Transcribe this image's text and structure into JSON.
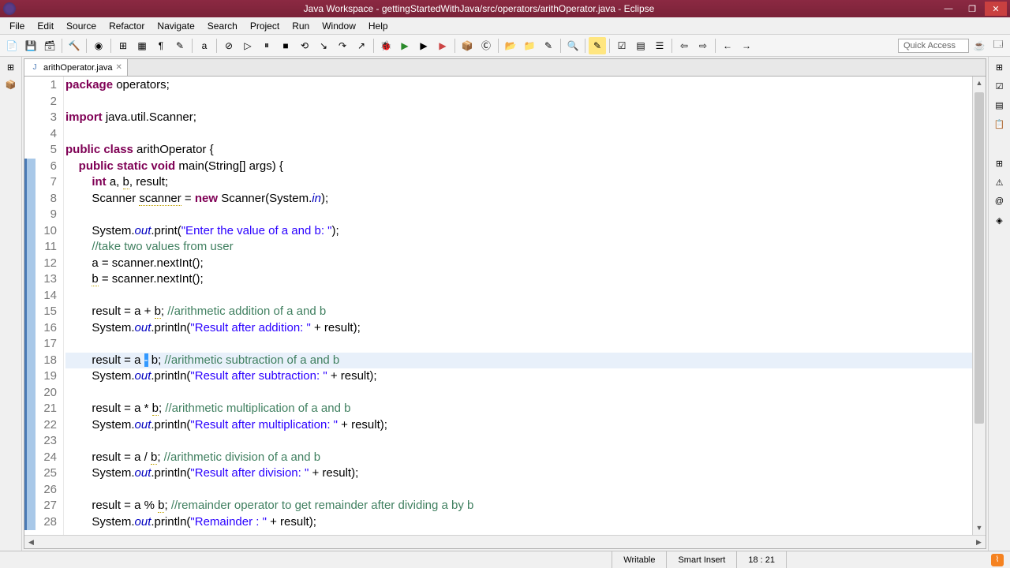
{
  "window": {
    "title": "Java Workspace - gettingStartedWithJava/src/operators/arithOperator.java - Eclipse"
  },
  "menu": [
    "File",
    "Edit",
    "Source",
    "Refactor",
    "Navigate",
    "Search",
    "Project",
    "Run",
    "Window",
    "Help"
  ],
  "quick_access": "Quick Access",
  "tab": {
    "label": "arithOperator.java"
  },
  "status": {
    "writable": "Writable",
    "insert": "Smart Insert",
    "pos": "18 : 21"
  },
  "code": {
    "lines": [
      {
        "n": 1,
        "seg": [
          {
            "c": "kw",
            "t": "package"
          },
          {
            "t": " operators;"
          }
        ]
      },
      {
        "n": 2,
        "seg": []
      },
      {
        "n": 3,
        "seg": [
          {
            "c": "kw",
            "t": "import"
          },
          {
            "t": " java.util.Scanner;"
          }
        ]
      },
      {
        "n": 4,
        "seg": []
      },
      {
        "n": 5,
        "seg": [
          {
            "c": "kw",
            "t": "public"
          },
          {
            "t": " "
          },
          {
            "c": "kw",
            "t": "class"
          },
          {
            "t": " arithOperator {"
          }
        ]
      },
      {
        "n": 6,
        "mark": true,
        "seg": [
          {
            "t": "    "
          },
          {
            "c": "kw",
            "t": "public"
          },
          {
            "t": " "
          },
          {
            "c": "kw",
            "t": "static"
          },
          {
            "t": " "
          },
          {
            "c": "kw",
            "t": "void"
          },
          {
            "t": " main(String[] args) {"
          }
        ]
      },
      {
        "n": 7,
        "mark": true,
        "seg": [
          {
            "t": "        "
          },
          {
            "c": "kw",
            "t": "int"
          },
          {
            "t": " a, "
          },
          {
            "c": "warn",
            "t": "b"
          },
          {
            "t": ", result;"
          }
        ]
      },
      {
        "n": 8,
        "mark": true,
        "seg": [
          {
            "t": "        Scanner "
          },
          {
            "c": "warn",
            "t": "scanner"
          },
          {
            "t": " = "
          },
          {
            "c": "kw",
            "t": "new"
          },
          {
            "t": " Scanner(System."
          },
          {
            "c": "fld",
            "t": "in"
          },
          {
            "t": ");"
          }
        ]
      },
      {
        "n": 9,
        "mark": true,
        "seg": []
      },
      {
        "n": 10,
        "mark": true,
        "seg": [
          {
            "t": "        System."
          },
          {
            "c": "fld",
            "t": "out"
          },
          {
            "t": ".print("
          },
          {
            "c": "str",
            "t": "\"Enter the value of a and b: \""
          },
          {
            "t": ");"
          }
        ]
      },
      {
        "n": 11,
        "mark": true,
        "seg": [
          {
            "t": "        "
          },
          {
            "c": "cmt",
            "t": "//take two values from user"
          }
        ]
      },
      {
        "n": 12,
        "mark": true,
        "seg": [
          {
            "t": "        a = scanner.nextInt();"
          }
        ]
      },
      {
        "n": 13,
        "mark": true,
        "seg": [
          {
            "t": "        "
          },
          {
            "c": "warn",
            "t": "b"
          },
          {
            "t": " = scanner.nextInt();"
          }
        ]
      },
      {
        "n": 14,
        "mark": true,
        "seg": []
      },
      {
        "n": 15,
        "mark": true,
        "seg": [
          {
            "t": "        result = a + "
          },
          {
            "c": "warn",
            "t": "b"
          },
          {
            "t": "; "
          },
          {
            "c": "cmt",
            "t": "//arithmetic addition of a and b"
          }
        ]
      },
      {
        "n": 16,
        "mark": true,
        "seg": [
          {
            "t": "        System."
          },
          {
            "c": "fld",
            "t": "out"
          },
          {
            "t": ".println("
          },
          {
            "c": "str",
            "t": "\"Result after addition: \""
          },
          {
            "t": " + result);"
          }
        ]
      },
      {
        "n": 17,
        "mark": true,
        "seg": []
      },
      {
        "n": 18,
        "mark": true,
        "hl": true,
        "seg": [
          {
            "t": "        result = a "
          },
          {
            "c": "sel",
            "t": "-"
          },
          {
            "t": " b; "
          },
          {
            "c": "cmt",
            "t": "//arithmetic subtraction of a and b"
          }
        ]
      },
      {
        "n": 19,
        "mark": true,
        "seg": [
          {
            "t": "        System."
          },
          {
            "c": "fld",
            "t": "out"
          },
          {
            "t": ".println("
          },
          {
            "c": "str",
            "t": "\"Result after subtraction: \""
          },
          {
            "t": " + result);"
          }
        ]
      },
      {
        "n": 20,
        "mark": true,
        "seg": []
      },
      {
        "n": 21,
        "mark": true,
        "seg": [
          {
            "t": "        result = a * "
          },
          {
            "c": "warn",
            "t": "b"
          },
          {
            "t": "; "
          },
          {
            "c": "cmt",
            "t": "//arithmetic multiplication of a and b"
          }
        ]
      },
      {
        "n": 22,
        "mark": true,
        "seg": [
          {
            "t": "        System."
          },
          {
            "c": "fld",
            "t": "out"
          },
          {
            "t": ".println("
          },
          {
            "c": "str",
            "t": "\"Result after multiplication: \""
          },
          {
            "t": " + result);"
          }
        ]
      },
      {
        "n": 23,
        "mark": true,
        "seg": []
      },
      {
        "n": 24,
        "mark": true,
        "seg": [
          {
            "t": "        result = a / "
          },
          {
            "c": "warn",
            "t": "b"
          },
          {
            "t": "; "
          },
          {
            "c": "cmt",
            "t": "//arithmetic division of a and b"
          }
        ]
      },
      {
        "n": 25,
        "mark": true,
        "seg": [
          {
            "t": "        System."
          },
          {
            "c": "fld",
            "t": "out"
          },
          {
            "t": ".println("
          },
          {
            "c": "str",
            "t": "\"Result after division: \""
          },
          {
            "t": " + result);"
          }
        ]
      },
      {
        "n": 26,
        "mark": true,
        "seg": []
      },
      {
        "n": 27,
        "mark": true,
        "seg": [
          {
            "t": "        result = a % "
          },
          {
            "c": "warn",
            "t": "b"
          },
          {
            "t": "; "
          },
          {
            "c": "cmt",
            "t": "//remainder operator to get remainder after dividing a by b"
          }
        ]
      },
      {
        "n": 28,
        "mark": true,
        "seg": [
          {
            "t": "        System."
          },
          {
            "c": "fld",
            "t": "out"
          },
          {
            "t": ".println("
          },
          {
            "c": "str",
            "t": "\"Remainder : \""
          },
          {
            "t": " + result);"
          }
        ]
      }
    ]
  }
}
